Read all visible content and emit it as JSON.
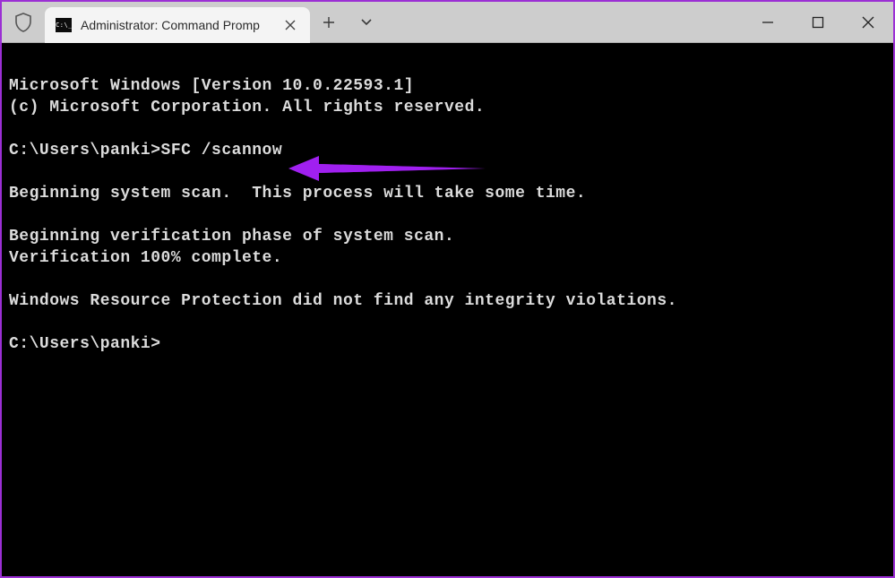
{
  "titlebar": {
    "tab_title": "Administrator: Command Promp",
    "icon_text": "C:\\_"
  },
  "terminal": {
    "line1": "Microsoft Windows [Version 10.0.22593.1]",
    "line2": "(c) Microsoft Corporation. All rights reserved.",
    "blank1": "",
    "prompt1_path": "C:\\Users\\panki>",
    "prompt1_cmd": "SFC /scannow",
    "blank2": "",
    "line3": "Beginning system scan.  This process will take some time.",
    "blank3": "",
    "line4": "Beginning verification phase of system scan.",
    "line5": "Verification 100% complete.",
    "blank4": "",
    "line6": "Windows Resource Protection did not find any integrity violations.",
    "blank5": "",
    "prompt2_path": "C:\\Users\\panki>"
  },
  "annotation": {
    "arrow_color": "#a020f0"
  }
}
